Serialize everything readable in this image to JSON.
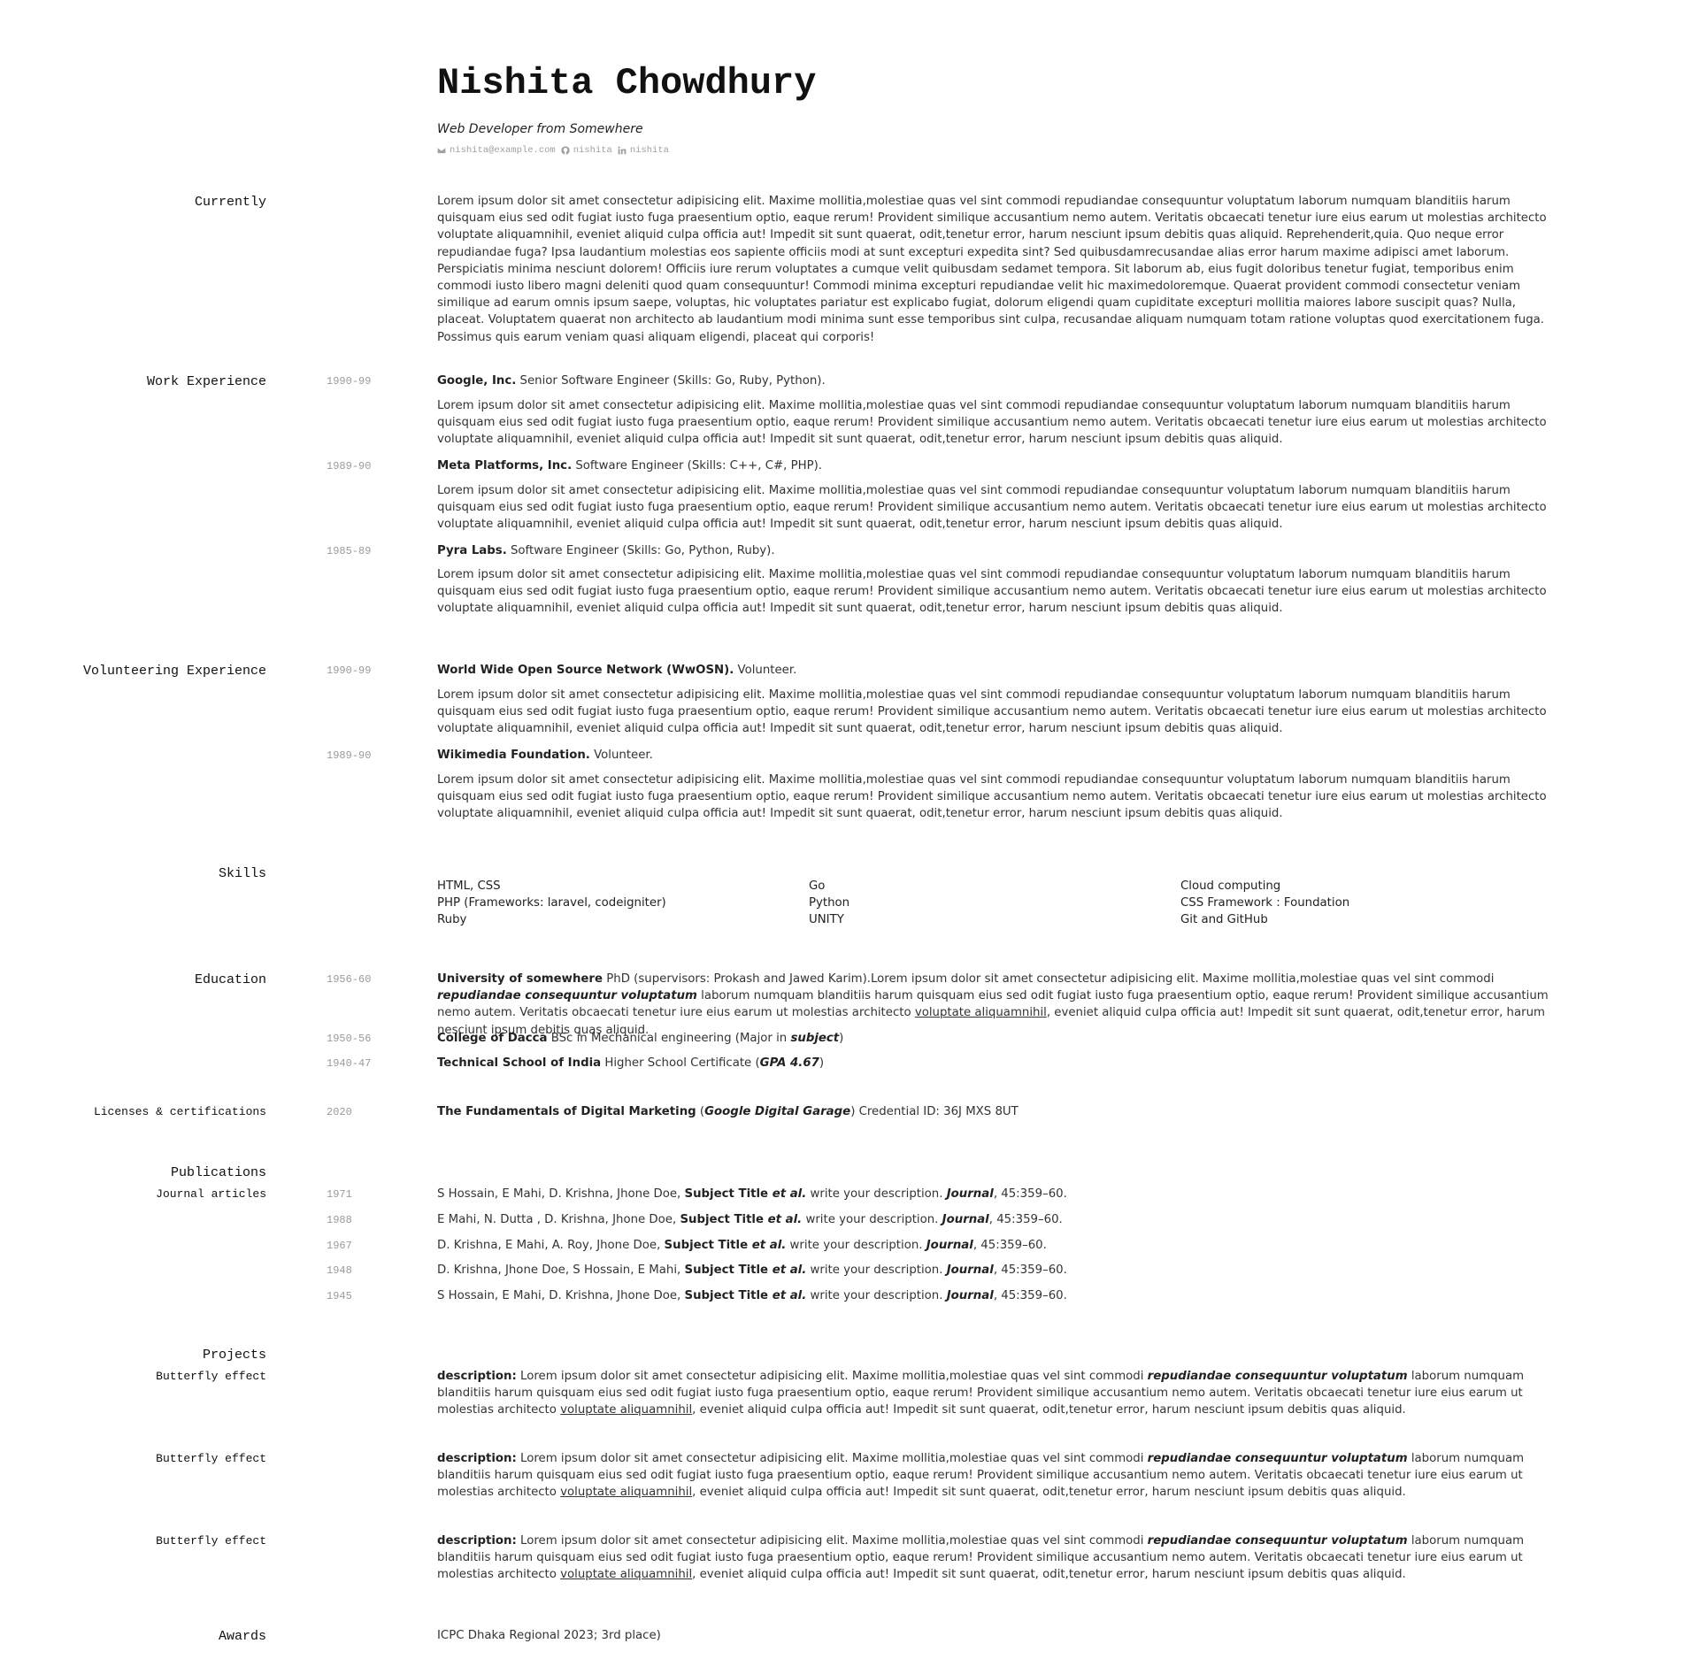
{
  "header": {
    "name": "Nishita Chowdhury",
    "subtitle": "Web Developer from Somewhere",
    "email": "nishita@example.com",
    "github": "nishita",
    "linkedin": "nishita"
  },
  "currently": {
    "label": "Currently",
    "text": "Lorem ipsum dolor sit amet consectetur adipisicing elit. Maxime mollitia,molestiae quas vel sint commodi repudiandae consequuntur voluptatum laborum numquam blanditiis harum quisquam eius sed odit fugiat iusto fuga praesentium optio, eaque rerum! Provident similique accusantium nemo autem. Veritatis obcaecati tenetur iure eius earum ut molestias architecto voluptate aliquamnihil, eveniet aliquid culpa officia aut! Impedit sit sunt quaerat, odit,tenetur error, harum nesciunt ipsum debitis quas aliquid. Reprehenderit,quia. Quo neque error repudiandae fuga? Ipsa laudantium molestias eos sapiente officiis modi at sunt excepturi expedita sint? Sed quibusdamrecusandae alias error harum maxime adipisci amet laborum. Perspiciatis minima nesciunt dolorem! Officiis iure rerum voluptates a cumque velit quibusdam sedamet tempora. Sit laborum ab, eius fugit doloribus tenetur fugiat, temporibus enim commodi iusto libero magni deleniti quod quam consequuntur! Commodi minima excepturi repudiandae velit hic maximedoloremque. Quaerat provident commodi consectetur veniam similique ad earum omnis ipsum saepe, voluptas, hic voluptates pariatur est explicabo fugiat, dolorum eligendi quam cupiditate excepturi mollitia maiores labore suscipit quas? Nulla, placeat. Voluptatem quaerat non architecto ab laudantium modi minima sunt esse temporibus sint culpa, recusandae aliquam numquam totam ratione voluptas quod exercitationem fuga. Possimus quis earum veniam quasi aliquam eligendi, placeat qui corporis!"
  },
  "lorem_short": "Lorem ipsum dolor sit amet consectetur adipisicing elit. Maxime mollitia,molestiae quas vel sint commodi repudiandae consequuntur voluptatum laborum numquam blanditiis harum quisquam eius sed odit fugiat iusto fuga praesentium optio, eaque rerum! Provident similique accusantium nemo autem. Veritatis obcaecati tenetur iure eius earum ut molestias architecto voluptate aliquamnihil, eveniet aliquid culpa officia aut! Impedit sit sunt quaerat, odit,tenetur error, harum nesciunt ipsum debitis quas aliquid.",
  "work": {
    "label": "Work Experience",
    "items": [
      {
        "date": "1990-99",
        "org": "Google, Inc.",
        "role": " Senior Software Engineer (Skills: Go, Ruby, Python)."
      },
      {
        "date": "1989-90",
        "org": "Meta Platforms, Inc.",
        "role": " Software Engineer (Skills: C++, C#, PHP)."
      },
      {
        "date": "1985-89",
        "org": "Pyra Labs.",
        "role": " Software Engineer (Skills: Go, Python, Ruby)."
      }
    ]
  },
  "volunteering": {
    "label": "Volunteering Experience",
    "items": [
      {
        "date": "1990-99",
        "org": "World Wide Open Source Network (WwOSN).",
        "role": " Volunteer."
      },
      {
        "date": "1989-90",
        "org": "Wikimedia Foundation.",
        "role": " Volunteer."
      }
    ]
  },
  "skills": {
    "label": "Skills",
    "columns": [
      [
        "HTML, CSS",
        "PHP (Frameworks: laravel, codeigniter)",
        "Ruby"
      ],
      [
        "Go",
        "Python",
        "UNITY"
      ],
      [
        "Cloud computing",
        "CSS Framework : Foundation",
        "Git and GitHub"
      ]
    ]
  },
  "education": {
    "label": "Education",
    "items": [
      {
        "date": "1956-60",
        "school": "University of somewhere",
        "t1": " PhD (supervisors: Prokash and Jawed Karim).Lorem ipsum dolor sit amet consectetur adipisicing elit. Maxime mollitia,molestiae quas vel sint commodi ",
        "em1": "repudiandae consequuntur voluptatum",
        "t2": " laborum numquam blanditiis harum quisquam eius sed odit fugiat iusto fuga praesentium optio, eaque rerum! Provident similique accusantium nemo autem. Veritatis obcaecati tenetur iure eius earum ut molestias architecto ",
        "u1": "voluptate aliquamnihil",
        "t3": ", eveniet aliquid culpa officia aut! Impedit sit sunt quaerat, odit,tenetur error, harum nesciunt ipsum debitis quas aliquid."
      },
      {
        "date": "1950-56",
        "school": "College of Dacca",
        "t1": " BSc in Mechanical engineering (Major in ",
        "em1": "subject",
        "t2": ")"
      },
      {
        "date": "1940-47",
        "school": "Technical School of India",
        "t1": " Higher School Certificate (",
        "em1": "GPA 4.67",
        "t2": ")"
      }
    ]
  },
  "licenses": {
    "label": "Licenses & certifications",
    "date": "2020",
    "title": "The Fundamentals of Digital Marketing",
    "t1": " (",
    "issuer": "Google Digital Garage",
    "t2": ") Credential ID: 36J MXS 8UT"
  },
  "publications": {
    "label": "Publications",
    "sublabel": "Journal articles",
    "items": [
      {
        "date": "1971",
        "authors": "S Hossain, E Mahi, D. Krishna, Jhone Doe, ",
        "title": "Subject Title ",
        "etal": "et al.",
        "desc": " write your description. ",
        "journal": "Journal",
        "tail": ", 45:359–60."
      },
      {
        "date": "1988",
        "authors": "E Mahi, N. Dutta , D. Krishna, Jhone Doe, ",
        "title": "Subject Title ",
        "etal": "et al.",
        "desc": " write your description. ",
        "journal": "Journal",
        "tail": ", 45:359–60."
      },
      {
        "date": "1967",
        "authors": "D. Krishna, E Mahi, A. Roy, Jhone Doe, ",
        "title": "Subject Title ",
        "etal": "et al.",
        "desc": " write your description. ",
        "journal": "Journal",
        "tail": ", 45:359–60."
      },
      {
        "date": "1948",
        "authors": "D. Krishna, Jhone Doe, S Hossain, E Mahi, ",
        "title": "Subject Title ",
        "etal": "et al.",
        "desc": " write your description. ",
        "journal": "Journal",
        "tail": ", 45:359–60."
      },
      {
        "date": "1945",
        "authors": "S Hossain, E Mahi, D. Krishna, Jhone Doe, ",
        "title": "Subject Title ",
        "etal": "et al.",
        "desc": " write your description. ",
        "journal": "Journal",
        "tail": ", 45:359–60."
      }
    ]
  },
  "projects": {
    "label": "Projects",
    "desc_label": "description:",
    "t1": " Lorem ipsum dolor sit amet consectetur adipisicing elit. Maxime mollitia,molestiae quas vel sint commodi ",
    "em1": "repudiandae consequuntur voluptatum",
    "t2": " laborum numquam blanditiis harum quisquam eius sed odit fugiat iusto fuga praesentium optio, eaque rerum! Provident similique accusantium nemo autem. Veritatis obcaecati tenetur iure eius earum ut molestias architecto ",
    "u1": "voluptate aliquamnihil",
    "t3": ", eveniet aliquid culpa officia aut! Impedit sit sunt quaerat, odit,tenetur error, harum nesciunt ipsum debitis quas aliquid.",
    "items": [
      {
        "name": "Butterfly effect"
      },
      {
        "name": "Butterfly effect"
      },
      {
        "name": "Butterfly effect"
      }
    ]
  },
  "awards": {
    "label": "Awards",
    "text": "ICPC Dhaka Regional 2023; 3rd place)"
  }
}
